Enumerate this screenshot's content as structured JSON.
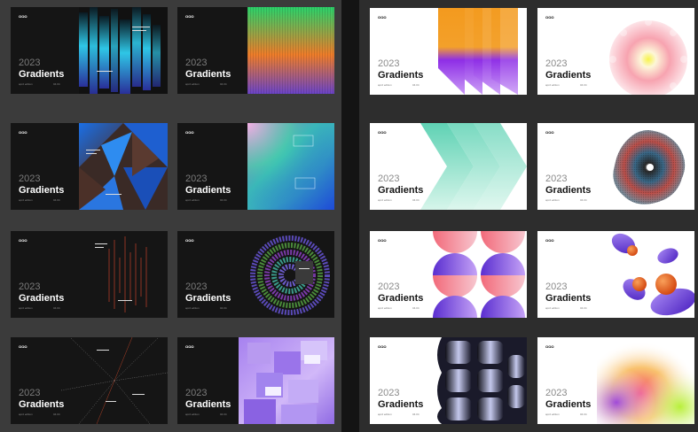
{
  "card_text": {
    "logo": "ΩΩΩ",
    "year": "2023",
    "title": "Gradients",
    "edition": "aprd edition",
    "date": "04.04"
  },
  "panels": {
    "left": "dark-theme-variants",
    "right": "light-theme-variants"
  }
}
